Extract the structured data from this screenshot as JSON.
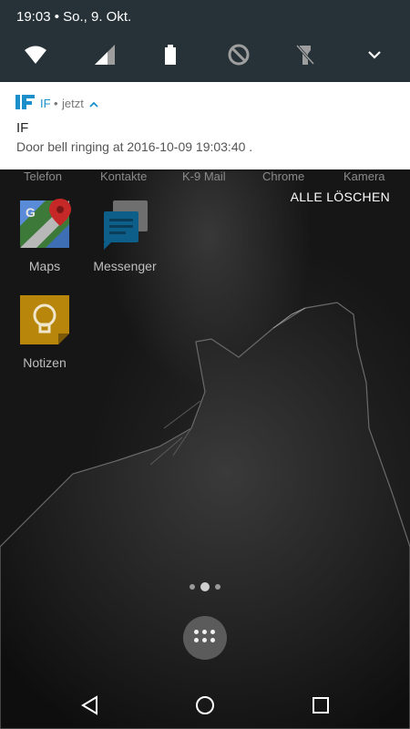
{
  "status_bar": {
    "time_date": "19:03 • So., 9. Okt."
  },
  "quick_settings": {
    "icons": [
      "wifi-icon",
      "signal-icon",
      "battery-icon",
      "do-not-disturb-icon",
      "flashlight-off-icon",
      "chevron-down-icon"
    ]
  },
  "notification": {
    "app_name": "IF",
    "separator": "•",
    "time": "jetzt",
    "title": "IF",
    "text": "Door bell ringing at 2016-10-09 19:03:40 .",
    "accent_color": "#1a8fc9"
  },
  "clear_all_label": "ALLE LÖSCHEN",
  "dock_peek_labels": [
    "Telefon",
    "Kontakte",
    "K-9 Mail",
    "Chrome",
    "Kamera"
  ],
  "apps": [
    {
      "label": "Maps",
      "icon": "maps-icon"
    },
    {
      "label": "Messenger",
      "icon": "messenger-icon"
    },
    {
      "label": "Notizen",
      "icon": "notes-icon"
    }
  ],
  "page_indicator": {
    "pages": 3,
    "current": 2
  },
  "nav_bar": {
    "icons": [
      "back-icon",
      "home-icon",
      "recents-icon"
    ]
  }
}
